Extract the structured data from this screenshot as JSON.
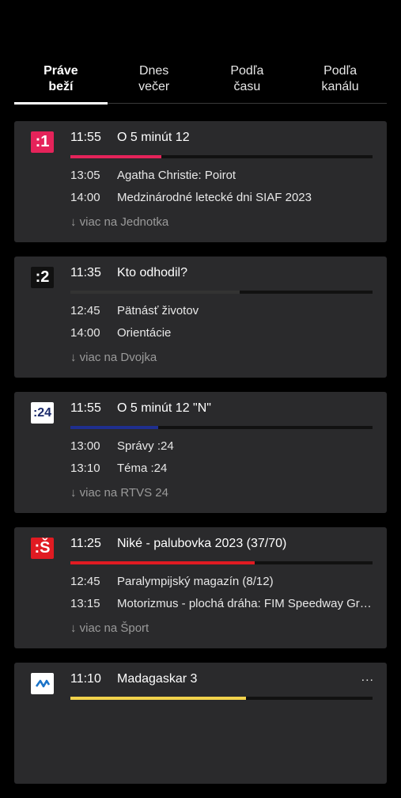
{
  "tabs": [
    {
      "label": "Práve\nbeží",
      "active": true
    },
    {
      "label": "Dnes\nvečer",
      "active": false
    },
    {
      "label": "Podľa\nčasu",
      "active": false
    },
    {
      "label": "Podľa\nkanálu",
      "active": false
    }
  ],
  "channels": [
    {
      "logo": ":1",
      "logo_bg": "#e5235a",
      "logo_fg": "#ffffff",
      "now_time": "11:55",
      "now_title": "O 5 minút 12",
      "progress": 0.3,
      "progress_color": "#e5235a",
      "programs": [
        {
          "time": "13:05",
          "title": "Agatha Christie: Poirot"
        },
        {
          "time": "14:00",
          "title": "Medzinárodné letecké dni SIAF 2023"
        }
      ],
      "more": "↓ viac na Jednotka"
    },
    {
      "logo": ":2",
      "logo_bg": "#111111",
      "logo_fg": "#ffffff",
      "now_time": "11:35",
      "now_title": "Kto odhodil?",
      "progress": 0.56,
      "progress_color": "#333333",
      "programs": [
        {
          "time": "12:45",
          "title": "Pätnásť životov"
        },
        {
          "time": "14:00",
          "title": "Orientácie"
        }
      ],
      "more": "↓ viac na Dvojka"
    },
    {
      "logo": ":24",
      "logo_bg": "#ffffff",
      "logo_fg": "#1b2a6b",
      "now_time": "11:55",
      "now_title": "O 5 minút 12 \"N\"",
      "progress": 0.29,
      "progress_color": "#1f2f8f",
      "programs": [
        {
          "time": "13:00",
          "title": "Správy :24"
        },
        {
          "time": "13:10",
          "title": "Téma :24"
        }
      ],
      "more": "↓ viac na RTVS 24"
    },
    {
      "logo": ":Š",
      "logo_bg": "#e01b22",
      "logo_fg": "#ffffff",
      "now_time": "11:25",
      "now_title": "Niké - palubovka 2023 (37/70)",
      "progress": 0.61,
      "progress_color": "#e01b22",
      "programs": [
        {
          "time": "12:45",
          "title": "Paralympijský magazín (8/12)"
        },
        {
          "time": "13:15",
          "title": "Motorizmus - plochá dráha: FIM Speedway Grand Prix"
        }
      ],
      "more": "↓ viac na Šport"
    },
    {
      "logo": "",
      "logo_bg": "#ffffff",
      "logo_fg": "#1a73c8",
      "now_time": "11:10",
      "now_title": "Madagaskar 3",
      "progress": 0.58,
      "progress_color": "#f2d24b",
      "menu": "...",
      "programs": [],
      "more": ""
    }
  ]
}
